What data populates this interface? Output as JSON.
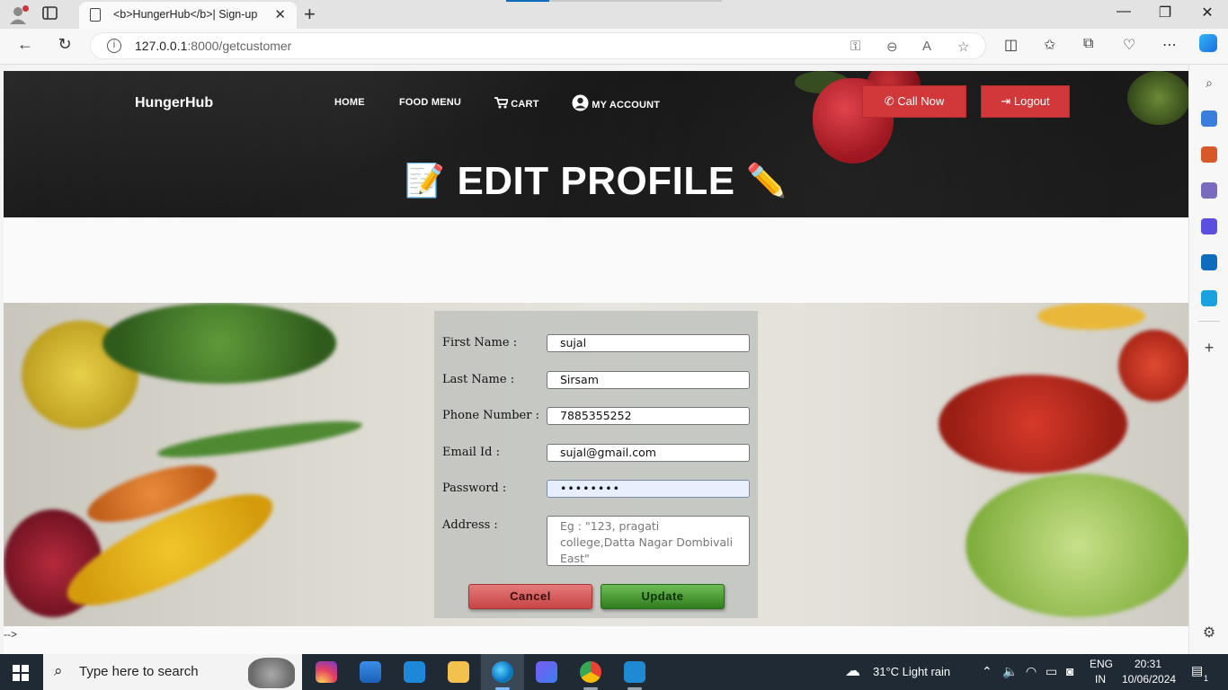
{
  "browser": {
    "tab_title": "<b>HungerHub</b>| Sign-up",
    "tab_close": "✕",
    "new_tab": "+",
    "url_host": "127.0.0.1",
    "url_rest": ":8000/getcustomer",
    "back": "←",
    "refresh": "↻",
    "minimize": "—",
    "restore": "❐",
    "close": "✕",
    "more": "⋯"
  },
  "site": {
    "brand": "HungerHub",
    "nav": [
      "HOME",
      "FOOD MENU",
      "CART",
      "MY ACCOUNT"
    ],
    "call_now": "Call Now",
    "logout": "Logout",
    "hero_title": "EDIT PROFILE",
    "hero_emoji_left": "📝",
    "hero_emoji_right": "✏️"
  },
  "form": {
    "labels": {
      "first_name": "First Name :",
      "last_name": "Last Name :",
      "phone": "Phone Number :",
      "email": "Email Id :",
      "password": "Password :",
      "address": "Address :"
    },
    "values": {
      "first_name": "sujal",
      "last_name": "Sirsam",
      "phone": "7885355252",
      "email": "sujal@gmail.com",
      "password": "••••••••"
    },
    "address_placeholder": "Eg : \"123, pragati college,Datta Nagar Dombivali East\"",
    "cancel": "Cancel",
    "update": "Update"
  },
  "page_footer": "-->",
  "taskbar": {
    "search_placeholder": "Type here to search",
    "weather": "31°C  Light rain",
    "lang_top": "ENG",
    "lang_bottom": "IN",
    "time": "20:31",
    "date": "10/06/2024",
    "notification_count": "1"
  },
  "colors": {
    "accent_red": "#d1383a",
    "update_green": "#4a9a35",
    "cancel_red": "#d45a5a"
  }
}
